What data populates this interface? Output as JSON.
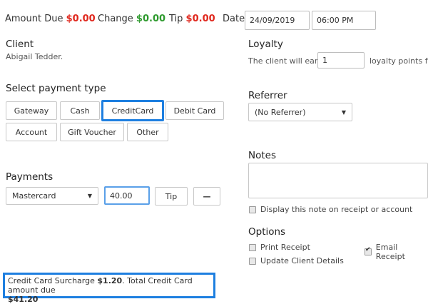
{
  "header": {
    "amount_due_label": "Amount Due",
    "amount_due_value": "$0.00",
    "change_label": "Change",
    "change_value": "$0.00",
    "tip_label": "Tip",
    "tip_value": "$0.00",
    "date_label": "Date",
    "date_value": "24/09/2019",
    "time_value": "06:00 PM"
  },
  "client": {
    "heading": "Client",
    "name": "Abigail Tedder."
  },
  "loyalty": {
    "heading": "Loyalty",
    "text_before": "The client will earn",
    "points_value": "1",
    "text_after": "loyalty points for"
  },
  "payment_type": {
    "heading": "Select payment type",
    "buttons": [
      "Gateway",
      "Cash",
      "CreditCard",
      "Debit Card",
      "Account",
      "Gift Voucher",
      "Other"
    ],
    "selected": "CreditCard"
  },
  "referrer": {
    "heading": "Referrer",
    "selected": "(No Referrer)"
  },
  "notes": {
    "heading": "Notes",
    "value": "",
    "display_on_receipt_label": "Display this note on receipt or account"
  },
  "payments": {
    "heading": "Payments",
    "method": "Mastercard",
    "amount": "40.00",
    "tip_button": "Tip",
    "remove_button": "—"
  },
  "options": {
    "heading": "Options",
    "print_receipt": "Print Receipt",
    "email_receipt": "Email Receipt",
    "update_client": "Update Client Details",
    "print_checked": false,
    "email_checked": true,
    "update_checked": false
  },
  "surcharge": {
    "prefix": "Credit Card Surcharge",
    "amount": "$1.20",
    "middle": ". Total Credit Card amount due",
    "total": "$41.20"
  },
  "colors": {
    "accent_blue": "#1e7fe0",
    "due_red": "#e0281e",
    "change_green": "#2e9a2e"
  }
}
